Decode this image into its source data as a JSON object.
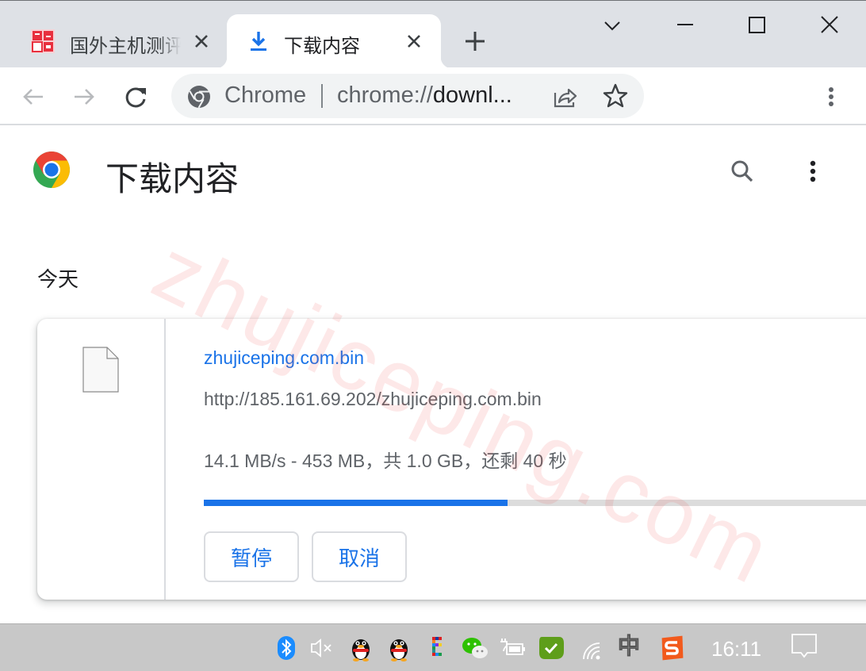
{
  "browser": {
    "tabs": [
      {
        "title": "国外主机测评",
        "active": false,
        "icon": "site-favicon"
      },
      {
        "title": "下载内容",
        "active": true,
        "icon": "download-icon"
      }
    ],
    "new_tab_icon": "plus-icon",
    "window_controls": [
      "tab-search-chevron",
      "minimize",
      "maximize",
      "close"
    ],
    "omnibox": {
      "chip": "Chrome",
      "url_scheme": "chrome://",
      "url_host": "downl...",
      "actions": [
        "share-icon",
        "star-icon"
      ]
    }
  },
  "page": {
    "title": "下载内容",
    "section_label": "今天",
    "watermark": "zhujiceping.com",
    "download": {
      "file_name": "zhujiceping.com.bin",
      "url": "http://185.161.69.202/zhujiceping.com.bin",
      "status": "14.1 MB/s - 453 MB，共 1.0 GB，还剩 40 秒",
      "progress_percent": 44,
      "pause_label": "暂停",
      "cancel_label": "取消"
    }
  },
  "colors": {
    "accent": "#1a73e8",
    "tabstrip": "#dee1e6",
    "progress_track": "#dcdcdc"
  },
  "taskbar": {
    "tray_icons": [
      "bluetooth-icon",
      "volume-muted-icon",
      "qq-icon",
      "qq-icon",
      "app-grid-icon",
      "wechat-icon",
      "power-plug-icon",
      "security-check-icon",
      "wifi-icon",
      "ime-chinese-icon",
      "sogou-input-icon"
    ],
    "ime_label": "中",
    "clock": "16:11",
    "notification_icon": "action-center-icon"
  }
}
